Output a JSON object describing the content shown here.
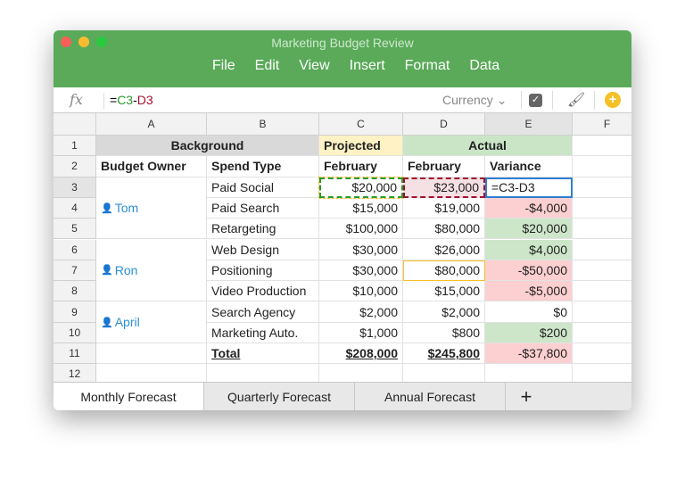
{
  "window": {
    "title": "Marketing Budget Review"
  },
  "menu": [
    "File",
    "Edit",
    "View",
    "Insert",
    "Format",
    "Data"
  ],
  "formula_bar": {
    "fx": "fx",
    "formula_prefix": "=",
    "ref1": "C3",
    "op": "-",
    "ref2": "D3",
    "format": "Currency"
  },
  "columns": [
    "A",
    "B",
    "C",
    "D",
    "E",
    "F"
  ],
  "rows": [
    "1",
    "2",
    "3",
    "4",
    "5",
    "6",
    "7",
    "8",
    "9",
    "10",
    "11",
    "12"
  ],
  "cells": {
    "header": {
      "background": "Background",
      "projected": "Projected",
      "actual": "Actual"
    },
    "subheader": {
      "owner": "Budget Owner",
      "spend": "Spend Type",
      "proj": "February",
      "act": "February",
      "var": "Variance"
    },
    "owners": [
      {
        "name": "Tom"
      },
      {
        "name": "Ron"
      },
      {
        "name": "April"
      }
    ],
    "lines": [
      {
        "spend": "Paid Social",
        "proj": "$20,000",
        "act": "$23,000",
        "var": "=C3-D3",
        "tone": "edit"
      },
      {
        "spend": "Paid Search",
        "proj": "$15,000",
        "act": "$19,000",
        "var": "-$4,000",
        "tone": "neg"
      },
      {
        "spend": "Retargeting",
        "proj": "$100,000",
        "act": "$80,000",
        "var": "$20,000",
        "tone": "pos"
      },
      {
        "spend": "Web Design",
        "proj": "$30,000",
        "act": "$26,000",
        "var": "$4,000",
        "tone": "pos"
      },
      {
        "spend": "Positioning",
        "proj": "$30,000",
        "act": "$80,000",
        "var": "-$50,000",
        "tone": "neg"
      },
      {
        "spend": "Video Production",
        "proj": "$10,000",
        "act": "$15,000",
        "var": "-$5,000",
        "tone": "neg"
      },
      {
        "spend": "Search Agency",
        "proj": "$2,000",
        "act": "$2,000",
        "var": "$0",
        "tone": "none"
      },
      {
        "spend": "Marketing Auto.",
        "proj": "$1,000",
        "act": "$800",
        "var": "$200",
        "tone": "pos"
      },
      {
        "spend": "Total",
        "proj": "$208,000",
        "act": "$245,800",
        "var": "-$37,800",
        "tone": "neg"
      }
    ]
  },
  "tabs": [
    "Monthly Forecast",
    "Quarterly Forecast",
    "Annual Forecast"
  ],
  "add_tab": "+",
  "colors": {
    "titlebar": "#5aaa59",
    "projected": "#fff2c4",
    "actual": "#c9e5c6",
    "neg": "#fccfd0",
    "pos": "#cde6c9",
    "selection": "#2f7fd0",
    "link": "#2a8fd6"
  }
}
